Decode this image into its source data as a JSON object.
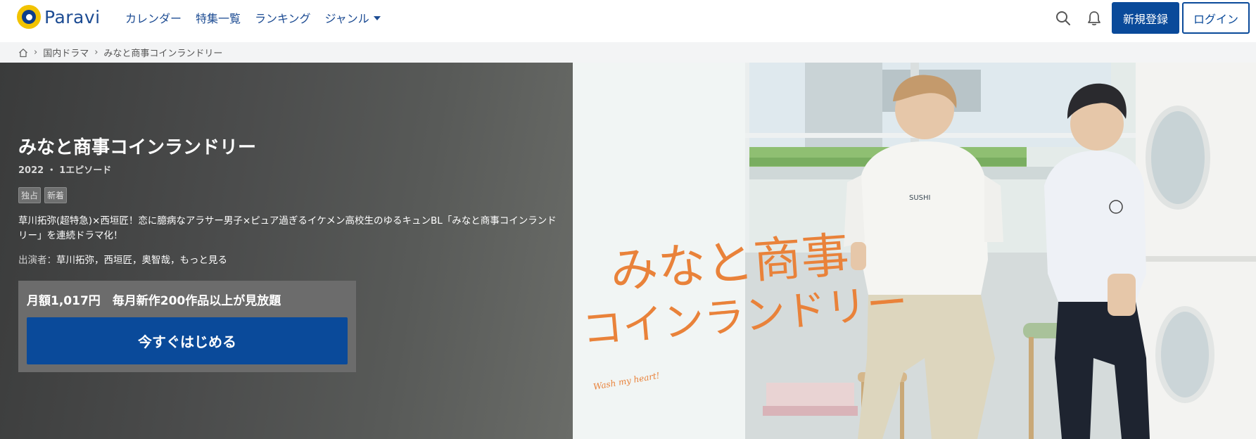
{
  "header": {
    "logo_text": "Paravi",
    "nav": [
      {
        "label": "カレンダー"
      },
      {
        "label": "特集一覧"
      },
      {
        "label": "ランキング"
      },
      {
        "label": "ジャンル"
      }
    ],
    "register_label": "新規登録",
    "login_label": "ログイン"
  },
  "breadcrumb": {
    "items": [
      "国内ドラマ",
      "みなと商事コインランドリー"
    ]
  },
  "show": {
    "title": "みなと商事コインランドリー",
    "meta": "2022 ・ 1エピソード",
    "tags": [
      "独占",
      "新着"
    ],
    "description": "草川拓弥(超特急)×西垣匠！恋に臆病なアラサー男子×ピュア過ぎるイケメン高校生のゆるキュンBL「みなと商事コインランドリー」を連続ドラマ化！",
    "cast_label": "出演者：",
    "cast": "草川拓弥，西垣匠，奥智哉，もっと見る"
  },
  "cta": {
    "text": "月額1,017円　毎月新作200作品以上が見放題",
    "button_label": "今すぐはじめる"
  },
  "key_art": {
    "title_line1": "みなと商事",
    "title_line2": "コインランドリー",
    "tagline": "Wash my heart!",
    "shirt_text": "SUSHI"
  },
  "colors": {
    "brand_blue": "#0a4a9a",
    "logo_yellow": "#f2c300",
    "art_orange": "#e9823a"
  }
}
